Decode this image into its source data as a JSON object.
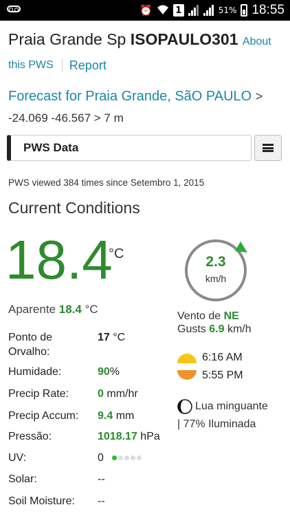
{
  "status_bar": {
    "battery": "51%",
    "time": "18:55",
    "sim_label": "1"
  },
  "header": {
    "station_name": "Praia Grande Sp",
    "station_id": "ISOPAULO301",
    "about_link": "About",
    "about_link_cont": "this PWS",
    "report_link": "Report",
    "forecast_link": "Forecast for Praia Grande, SãO PAULO",
    "forecast_arrow": ">",
    "coords": "-24.069 -46.567 > 7 m"
  },
  "pws_select": {
    "label": "PWS Data"
  },
  "views_text": "PWS viewed 384 times since Setembro 1, 2015",
  "section_title": "Current Conditions",
  "temperature": {
    "value": "18.4",
    "unit": "°C"
  },
  "apparent": {
    "label": "Aparente",
    "value": "18.4",
    "unit": "°C"
  },
  "conditions": [
    {
      "label": "Ponto de Orvalho:",
      "value": "17",
      "unit": "°C",
      "highlight": false
    },
    {
      "label": "Humidade:",
      "value": "90",
      "unit": "%",
      "highlight": true
    },
    {
      "label": "Precip Rate:",
      "value": "0",
      "unit": "mm/hr",
      "highlight": true
    },
    {
      "label": "Precip Accum:",
      "value": "9.4",
      "unit": "mm",
      "highlight": true
    },
    {
      "label": "Pressão:",
      "value": "1018.17",
      "unit": "hPa",
      "highlight": true
    },
    {
      "label": "UV:",
      "value": "0",
      "unit": "",
      "highlight": false
    },
    {
      "label": "Solar:",
      "value": "--",
      "unit": "",
      "highlight": false
    },
    {
      "label": "Soil Moisture:",
      "value": "--",
      "unit": "",
      "highlight": false
    }
  ],
  "uv_index_level": 1,
  "uv_index_max": 5,
  "wind": {
    "speed": "2.3",
    "unit": "km/h",
    "direction_label": "Vento de",
    "direction": "NE",
    "gusts_label": "Gusts",
    "gusts_value": "6.9",
    "gusts_unit": "km/h"
  },
  "sun": {
    "sunrise": "6:16 AM",
    "sunset": "5:55 PM"
  },
  "moon": {
    "phase": "Lua minguante",
    "illumination": "| 77% Iluminada"
  },
  "colors": {
    "accent_link": "#1a87a5",
    "value_green": "#2e8b2e",
    "sun_yellow": "#f5c518",
    "sun_orange": "#f0922b"
  }
}
